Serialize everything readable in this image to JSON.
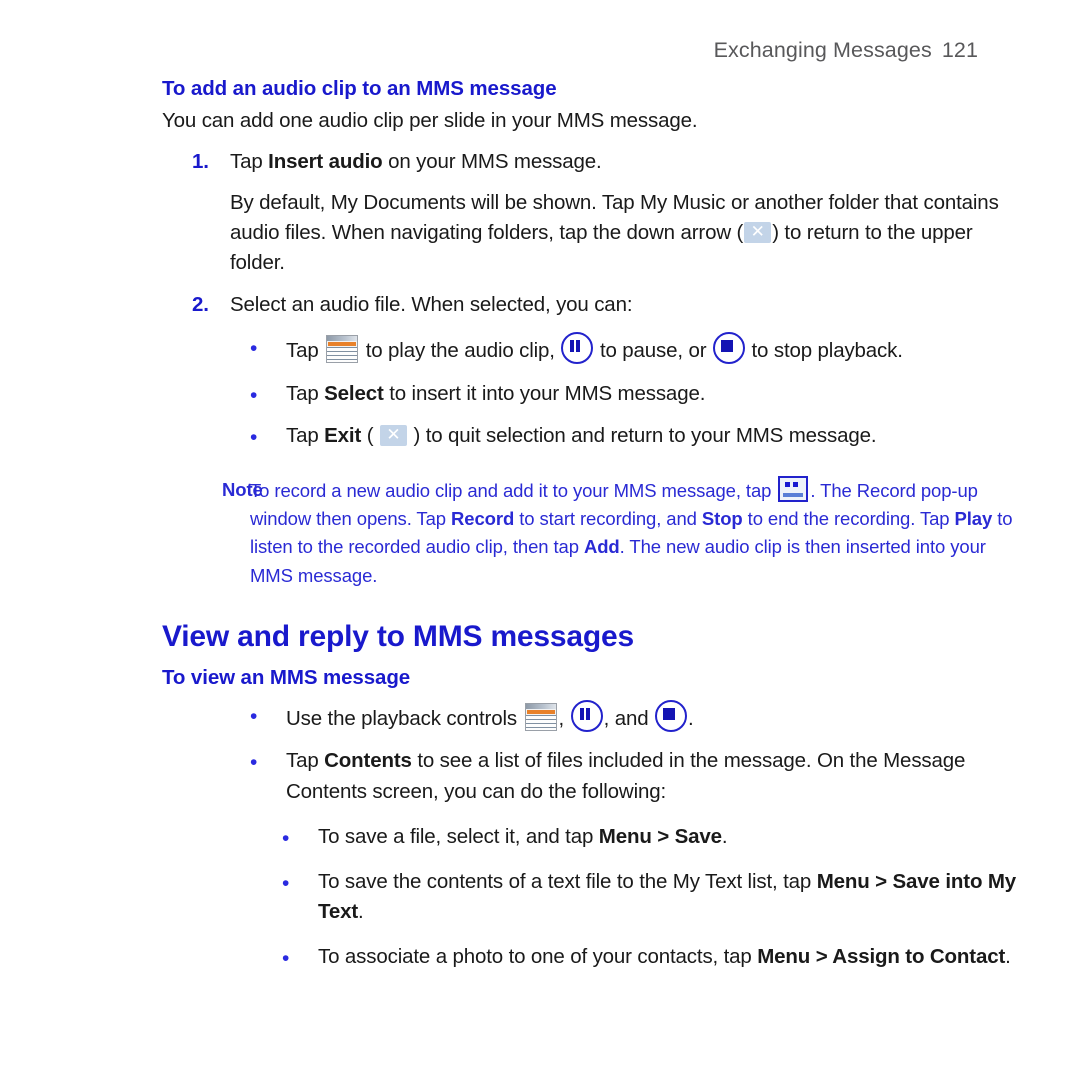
{
  "header": {
    "chapter": "Exchanging Messages",
    "page_number": "121"
  },
  "sections": {
    "add_audio": {
      "heading": "To add an audio clip to an MMS message",
      "intro": "You can add one audio clip per slide in your MMS message.",
      "step1": {
        "number": "1.",
        "text_before": "Tap ",
        "bold": "Insert audio",
        "text_after": " on your MMS message."
      },
      "step1_detail_a": "By default, My Documents will be shown. Tap My Music or another folder that contains audio files. When navigating folders, tap the down arrow (",
      "step1_detail_b": ") to return to the upper folder.",
      "step2": {
        "number": "2.",
        "text": "Select an audio file. When selected, you can:"
      },
      "bullets": [
        {
          "a": "Tap ",
          "b": " to play the audio clip, ",
          "c": " to pause, or ",
          "d": " to stop playback."
        },
        {
          "a": "Tap ",
          "bold": "Select",
          "b": " to insert it into your MMS message."
        },
        {
          "a": "Tap ",
          "bold": "Exit",
          "b": " ( ",
          "c": " ) to quit selection and return to your MMS message."
        }
      ]
    },
    "note": {
      "label": "Note",
      "part1": "To record a new audio clip and add it to your MMS message, tap ",
      "part2": ". The Record pop-up window then opens. Tap ",
      "bold1": "Record",
      "part3": " to start recording, and ",
      "bold2": "Stop",
      "part4": " to end the recording. Tap ",
      "bold3": "Play",
      "part5": " to listen to the recorded audio clip, then tap ",
      "bold4": "Add",
      "part6": ". The new audio clip is then inserted into your MMS message."
    },
    "view_reply": {
      "heading": "View and reply to MMS messages",
      "sub_heading": "To view an MMS message",
      "bullet_playback": {
        "a": "Use the playback controls ",
        "b": ", ",
        "c": ", and ",
        "d": "."
      },
      "bullet_contents": {
        "a": "Tap ",
        "bold": "Contents",
        "b": " to see a list of files included in the message. On the Message Contents screen, you can do the following:"
      },
      "sub_bullets": [
        {
          "a": "To save a file, select it, and tap ",
          "bold": "Menu > Save",
          "b": "."
        },
        {
          "a": "To save the contents of a text file to the My Text list, tap ",
          "bold": "Menu > Save into My Text",
          "b": "."
        },
        {
          "a": "To associate a photo to one of your contacts, tap ",
          "bold": "Menu > Assign to Contact",
          "b": "."
        }
      ]
    }
  },
  "icons": {
    "down_arrow_glyph": "✕",
    "exit_glyph": "✕"
  },
  "colors": {
    "heading_blue": "#1919cc",
    "note_blue": "#2a2ad4",
    "bullet_blue": "#2a2ae0",
    "header_gray": "#58585a",
    "body_black": "#1a1a1a"
  }
}
